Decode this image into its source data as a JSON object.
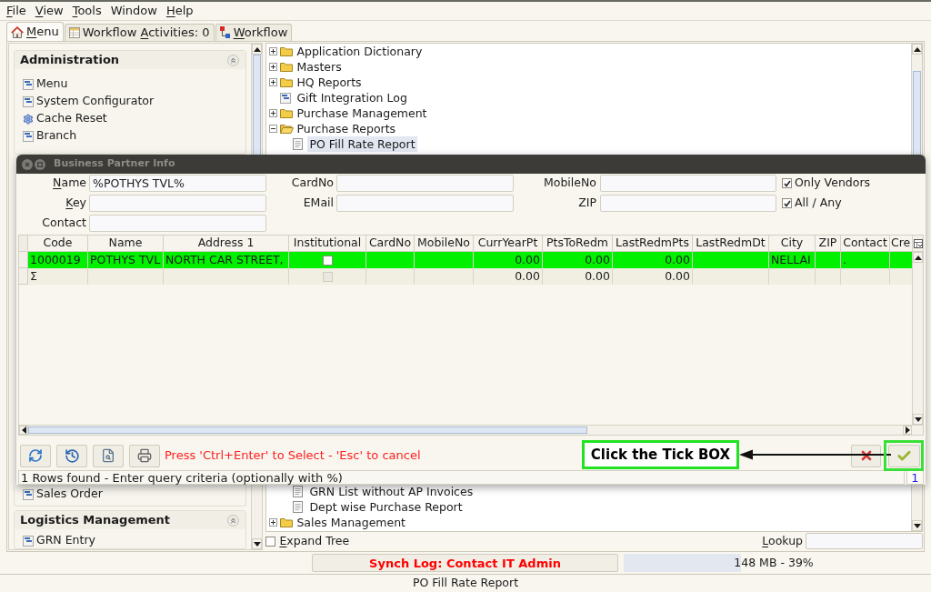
{
  "menu_bar": [
    {
      "label": "File",
      "mnemonic": true
    },
    {
      "label": "View",
      "mnemonic": true
    },
    {
      "label": "Tools",
      "mnemonic": true
    },
    {
      "label": "Window",
      "mnemonic": false
    },
    {
      "label": "Help",
      "mnemonic": true
    }
  ],
  "tabs": [
    {
      "label": "Menu",
      "mnemonic": true,
      "kind": "home",
      "selected": true
    },
    {
      "label": "Workflow Activities: 0",
      "mnemonic": true,
      "mnemonic_in_second_word": true,
      "kind": "activities",
      "selected": false
    },
    {
      "label": "Workflow",
      "mnemonic": true,
      "kind": "workflow",
      "selected": false
    }
  ],
  "sidebar": {
    "sections": [
      {
        "title": "Administration",
        "items": [
          {
            "label": "Menu",
            "kind": "window"
          },
          {
            "label": "System Configurator",
            "kind": "window"
          },
          {
            "label": "Cache Reset",
            "kind": "process"
          },
          {
            "label": "Branch",
            "kind": "window"
          }
        ]
      },
      {
        "items": [
          {
            "label": "Sales Order",
            "kind": "window"
          }
        ]
      },
      {
        "title": "Logistics Management",
        "items": [
          {
            "label": "GRN Entry",
            "kind": "window"
          }
        ]
      }
    ]
  },
  "menu_tree": {
    "items": [
      {
        "label": "Application Dictionary",
        "kind": "folder",
        "expanded": false,
        "selected": false
      },
      {
        "label": "Masters",
        "kind": "folder",
        "expanded": false,
        "selected": false
      },
      {
        "label": "HQ Reports",
        "kind": "folder",
        "expanded": false,
        "selected": false
      },
      {
        "label": "Gift Integration Log",
        "kind": "window",
        "selected": false
      },
      {
        "label": "Purchase Management",
        "kind": "folder",
        "expanded": false,
        "selected": false
      },
      {
        "label": "Purchase Reports",
        "kind": "folder",
        "expanded": true,
        "selected": false,
        "children": [
          {
            "label": "PO Fill Rate Report",
            "kind": "report",
            "selected": true
          },
          {
            "label": "GRN List without AP Invoices",
            "kind": "report",
            "selected": false
          },
          {
            "label": "Dept wise Purchase Report",
            "kind": "report",
            "selected": false
          }
        ]
      },
      {
        "label": "Sales Management",
        "kind": "folder",
        "expanded": false,
        "selected": false
      }
    ],
    "expand_tree": {
      "label": "Expand Tree",
      "mnemonic": true,
      "checked": false
    },
    "lookup": {
      "label": "Lookup",
      "mnemonic": true
    }
  },
  "dialog": {
    "title": "Business Partner Info",
    "search_columns": [
      {
        "fields": [
          {
            "label": "Name",
            "mnemonic": true,
            "value": "%POTHYS TVL%"
          },
          {
            "label": "Key",
            "mnemonic": true
          },
          {
            "label": "Contact",
            "mnemonic": false
          }
        ]
      },
      {
        "fields": [
          {
            "label": "CardNo",
            "mnemonic": false
          },
          {
            "label": "EMail",
            "mnemonic": false
          }
        ]
      },
      {
        "fields": [
          {
            "label": "MobileNo",
            "mnemonic": false
          },
          {
            "label": "ZIP",
            "mnemonic": false
          }
        ]
      }
    ],
    "options": [
      {
        "label": "Only Vendors",
        "checked": true
      },
      {
        "label": "All / Any",
        "checked": true
      }
    ],
    "table": {
      "columns": [
        {
          "label": "Code",
          "kind": "text"
        },
        {
          "label": "Name",
          "kind": "text"
        },
        {
          "label": "Address 1",
          "kind": "text"
        },
        {
          "label": "Institutional",
          "kind": "checkbox"
        },
        {
          "label": "CardNo",
          "kind": "text"
        },
        {
          "label": "MobileNo",
          "kind": "text"
        },
        {
          "label": "CurrYearPt",
          "kind": "number"
        },
        {
          "label": "PtsToRedm",
          "kind": "number"
        },
        {
          "label": "LastRedmPts",
          "kind": "number"
        },
        {
          "label": "LastRedmDt",
          "kind": "text"
        },
        {
          "label": "City",
          "kind": "text"
        },
        {
          "label": "ZIP",
          "kind": "text"
        },
        {
          "label": "Contact",
          "kind": "text"
        },
        {
          "label": "Cre",
          "kind": "text"
        }
      ],
      "rows": [
        {
          "kind": "record",
          "selected": true,
          "cells": [
            "1000019",
            "POTHYS TVL",
            "NORTH CAR STREET,",
            {
              "checked": false,
              "disabled": false
            },
            null,
            null,
            "0.00",
            "0.00",
            "0.00",
            null,
            "NELLAI",
            null,
            ".",
            null
          ]
        },
        {
          "kind": "total",
          "selected": false,
          "cells": [
            "Σ",
            null,
            null,
            {
              "checked": false,
              "disabled": true
            },
            null,
            null,
            "0.00",
            "0.00",
            "0.00",
            null,
            null,
            null,
            null,
            null
          ]
        }
      ]
    },
    "hint": "Press 'Ctrl+Enter' to Select - 'Esc' to cancel",
    "status": "1 Rows found - Enter query criteria (optionally with %)",
    "record_count": "1"
  },
  "annotation": {
    "text": "Click the Tick BOX"
  },
  "status": {
    "synch_log": "Synch Log: Contact IT Admin",
    "memory": {
      "reading": "148 MB - 39%",
      "level": 0.39
    }
  },
  "status_bar": {
    "text": "PO Fill Rate Report"
  }
}
